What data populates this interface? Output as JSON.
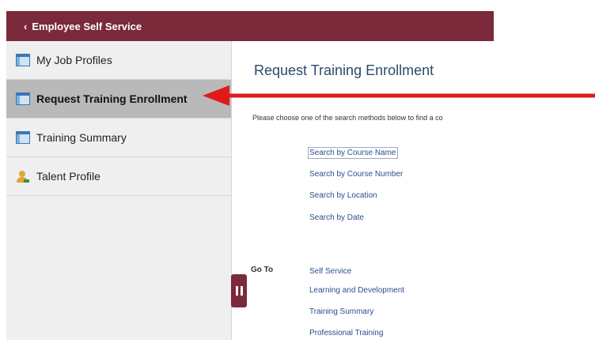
{
  "header": {
    "back_label": "Employee Self Service"
  },
  "sidebar": {
    "items": [
      {
        "label": "My Job Profiles",
        "icon": "list-page-icon"
      },
      {
        "label": "Request Training Enrollment",
        "icon": "list-page-icon",
        "active": true
      },
      {
        "label": "Training Summary",
        "icon": "list-page-icon"
      },
      {
        "label": "Talent Profile",
        "icon": "person-icon"
      }
    ]
  },
  "main": {
    "title": "Request Training Enrollment",
    "instructions": "Please choose one of the search methods below to find a co",
    "search_links": [
      "Search by Course Name",
      "Search by Course Number",
      "Search by Location",
      "Search by Date"
    ],
    "goto_label": "Go To",
    "goto_links": [
      "Self Service",
      "Learning and Development",
      "Training Summary",
      "Professional Training"
    ]
  },
  "colors": {
    "brand": "#7a2a3a",
    "title": "#2d4a6e",
    "link": "#2a4f8a",
    "annotation_arrow": "#e01a1a"
  }
}
